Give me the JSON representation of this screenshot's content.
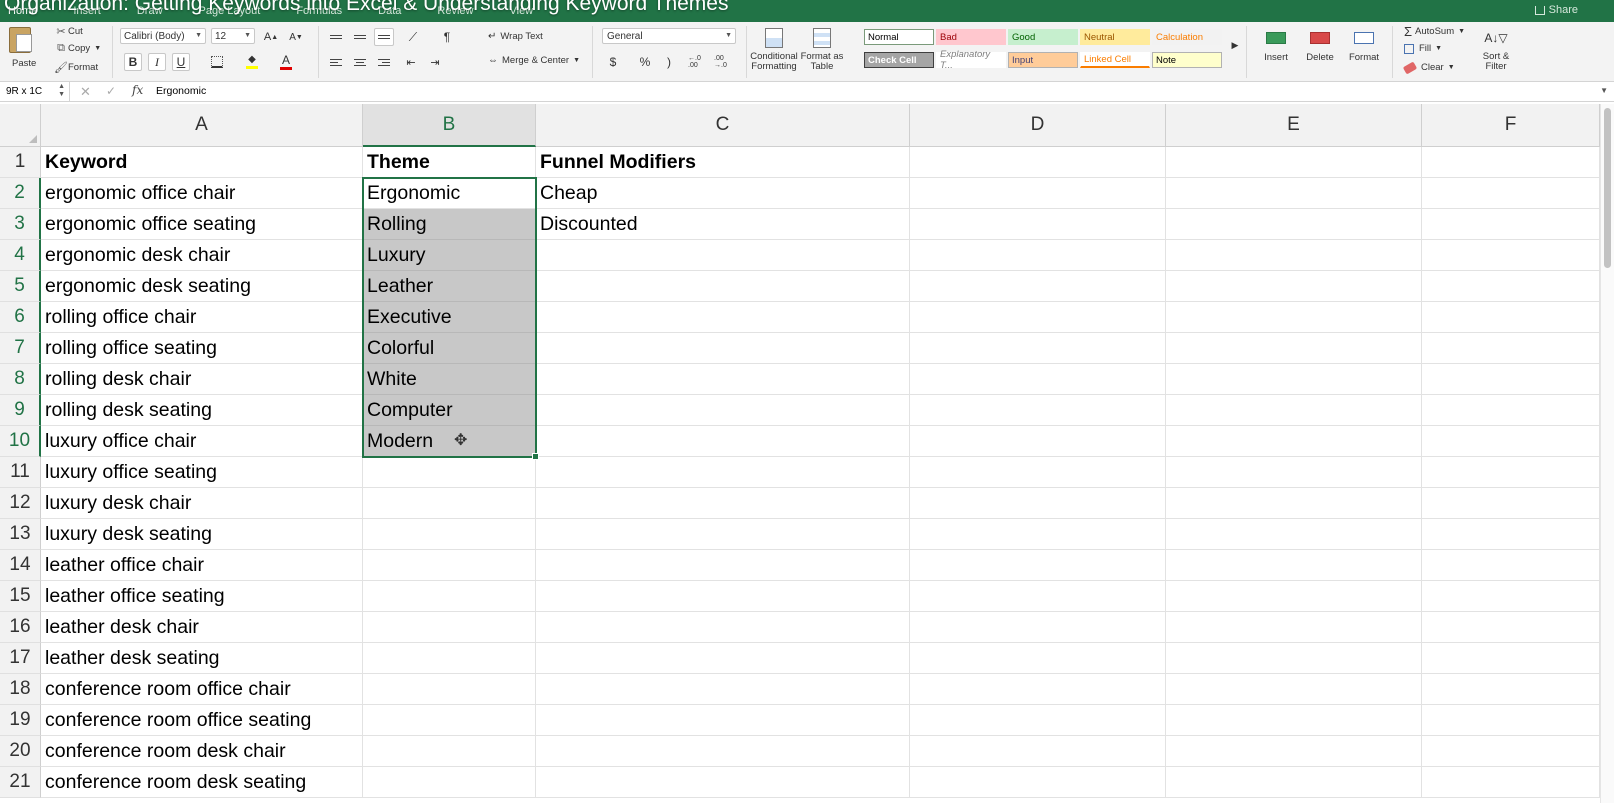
{
  "titlebar": {
    "video_title": "Organization: Getting Keywords into Excel & Understanding Keyword Themes",
    "tabs": [
      "Home",
      "Insert",
      "Draw",
      "Page Layout",
      "Formulas",
      "Data",
      "Review",
      "View"
    ],
    "share": "Share"
  },
  "ribbon": {
    "clipboard": {
      "paste": "Paste",
      "cut": "Cut",
      "copy": "Copy",
      "format": "Format"
    },
    "font": {
      "name": "Calibri (Body)",
      "size": "12",
      "bold": "B",
      "italic": "I",
      "underline": "U"
    },
    "alignment": {
      "wrap_text": "Wrap Text",
      "merge_center": "Merge & Center"
    },
    "number": {
      "format": "General",
      "currency": "$",
      "percent": "%",
      "comma": ")",
      "inc_decimal": "←.0 .00",
      "dec_decimal": ".00 →.0"
    },
    "styles": {
      "conditional_formatting": "Conditional Formatting",
      "format_as_table": "Format as Table",
      "cells": [
        {
          "label": "Normal",
          "bg": "#ffffff",
          "fg": "#000000"
        },
        {
          "label": "Bad",
          "bg": "#ffc7ce",
          "fg": "#9c0006"
        },
        {
          "label": "Good",
          "bg": "#c6efce",
          "fg": "#006100"
        },
        {
          "label": "Neutral",
          "bg": "#ffeb9c",
          "fg": "#9c5700"
        },
        {
          "label": "Calculation",
          "bg": "#f2f2f2",
          "fg": "#fa7d00"
        },
        {
          "label": "Check Cell",
          "bg": "#a5a5a5",
          "fg": "#ffffff"
        },
        {
          "label": "Explanatory T...",
          "bg": "#ffffff",
          "fg": "#7f7f7f"
        },
        {
          "label": "Input",
          "bg": "#ffcc99",
          "fg": "#3f3f76"
        },
        {
          "label": "Linked Cell",
          "bg": "#ffffff",
          "fg": "#fa7d00"
        },
        {
          "label": "Note",
          "bg": "#ffffcc",
          "fg": "#000000"
        }
      ]
    },
    "cells": {
      "insert": "Insert",
      "delete": "Delete",
      "format": "Format"
    },
    "editing": {
      "autosum": "AutoSum",
      "fill": "Fill",
      "clear": "Clear",
      "sort_filter": "Sort & Filter"
    }
  },
  "formula_bar": {
    "name_box": "9R x 1C",
    "fx": "fx",
    "value": "Ergonomic"
  },
  "sheet": {
    "columns": [
      "A",
      "B",
      "C",
      "D",
      "E",
      "F"
    ],
    "selected_column": "B",
    "rows": [
      {
        "n": "1",
        "a": "Keyword",
        "b": "Theme",
        "c": "Funnel Modifiers"
      },
      {
        "n": "2",
        "a": "ergonomic office chair",
        "b": "Ergonomic",
        "c": "Cheap"
      },
      {
        "n": "3",
        "a": "ergonomic office seating",
        "b": "Rolling",
        "c": "Discounted"
      },
      {
        "n": "4",
        "a": "ergonomic desk chair",
        "b": "Luxury",
        "c": ""
      },
      {
        "n": "5",
        "a": "ergonomic desk seating",
        "b": "Leather",
        "c": ""
      },
      {
        "n": "6",
        "a": "rolling office chair",
        "b": "Executive",
        "c": ""
      },
      {
        "n": "7",
        "a": "rolling office seating",
        "b": "Colorful",
        "c": ""
      },
      {
        "n": "8",
        "a": "rolling desk chair",
        "b": "White",
        "c": ""
      },
      {
        "n": "9",
        "a": "rolling desk seating",
        "b": "Computer",
        "c": ""
      },
      {
        "n": "10",
        "a": "luxury office chair",
        "b": "Modern",
        "c": ""
      },
      {
        "n": "11",
        "a": "luxury office seating",
        "b": "",
        "c": ""
      },
      {
        "n": "12",
        "a": "luxury desk chair",
        "b": "",
        "c": ""
      },
      {
        "n": "13",
        "a": "luxury desk seating",
        "b": "",
        "c": ""
      },
      {
        "n": "14",
        "a": "leather office chair",
        "b": "",
        "c": ""
      },
      {
        "n": "15",
        "a": "leather office seating",
        "b": "",
        "c": ""
      },
      {
        "n": "16",
        "a": "leather desk chair",
        "b": "",
        "c": ""
      },
      {
        "n": "17",
        "a": "leather desk seating",
        "b": "",
        "c": ""
      },
      {
        "n": "18",
        "a": "conference room office chair",
        "b": "",
        "c": ""
      },
      {
        "n": "19",
        "a": "conference room office seating",
        "b": "",
        "c": ""
      },
      {
        "n": "20",
        "a": "conference room desk chair",
        "b": "",
        "c": ""
      },
      {
        "n": "21",
        "a": "conference room desk seating",
        "b": "",
        "c": ""
      }
    ]
  },
  "colors": {
    "accent": "#217346",
    "selection_fill": "#c8c8c8"
  }
}
